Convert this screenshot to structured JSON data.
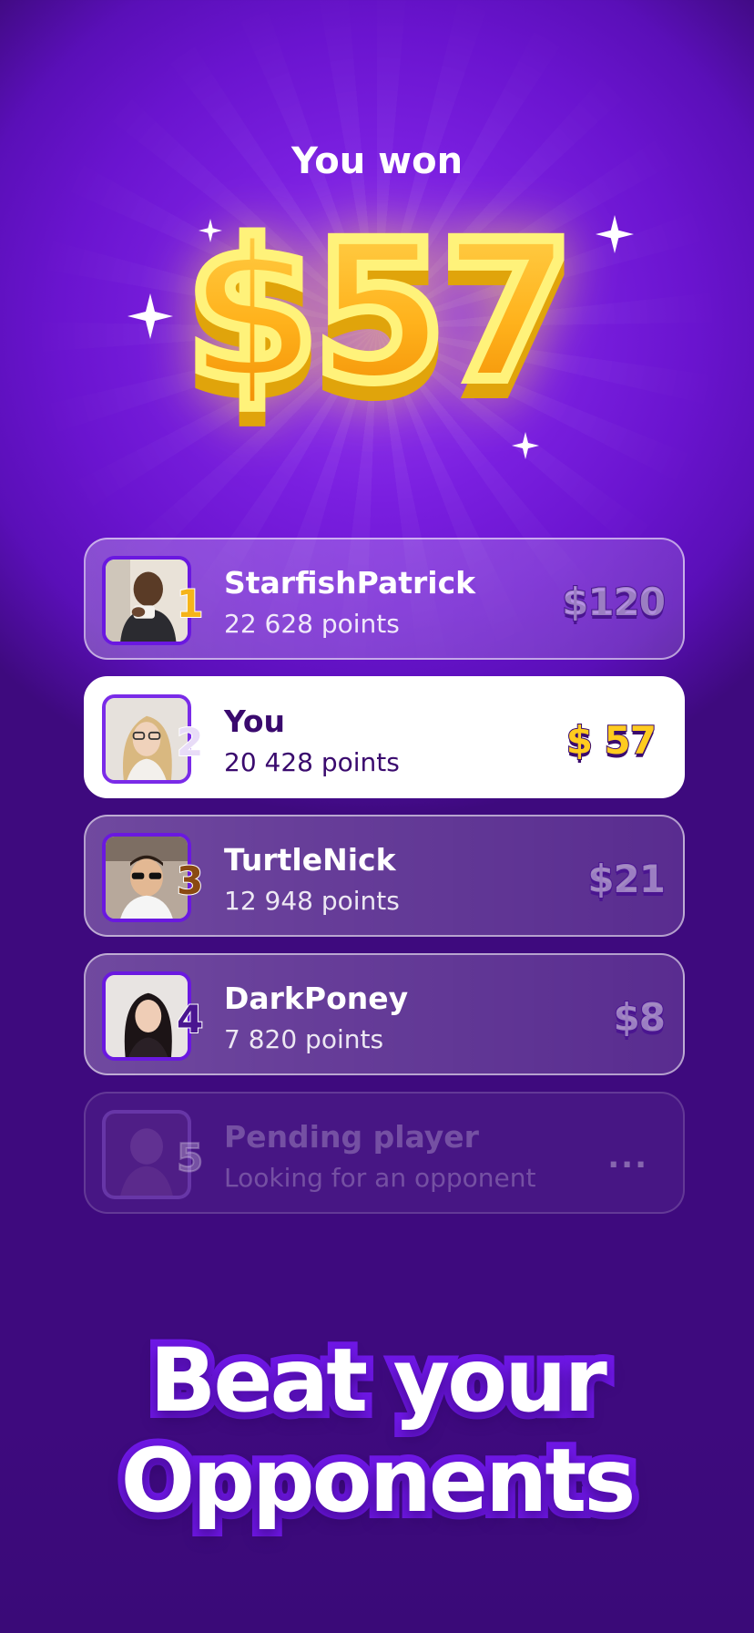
{
  "header": {
    "label": "You won"
  },
  "prize": {
    "amount": "$57",
    "gradient_top": "#ffd04a",
    "gradient_bottom": "#f28f05"
  },
  "leaderboard": {
    "rows": [
      {
        "rank": "1",
        "name": "StarfishPatrick",
        "points": "22 628 points",
        "amount": "$120",
        "avatar": "man-drinking-avatar"
      },
      {
        "rank": "2",
        "name": "You",
        "points": "20 428 points",
        "amount": "$ 57",
        "avatar": "woman-blonde-avatar",
        "highlighted": true
      },
      {
        "rank": "3",
        "name": "TurtleNick",
        "points": "12 948 points",
        "amount": "$21",
        "avatar": "man-sunglasses-avatar"
      },
      {
        "rank": "4",
        "name": "DarkPoney",
        "points": "7 820 points",
        "amount": "$8",
        "avatar": "woman-dark-hair-avatar"
      },
      {
        "rank": "5",
        "name": "Pending player",
        "points": "Looking for an opponent",
        "amount": "...",
        "avatar": "pending-avatar",
        "pending": true
      }
    ]
  },
  "tagline": {
    "line1": "Beat your",
    "line2": "Opponents"
  },
  "colors": {
    "background": "#6a14cf",
    "accent": "#ffcb1f",
    "text_dark": "#3a0a6e"
  }
}
